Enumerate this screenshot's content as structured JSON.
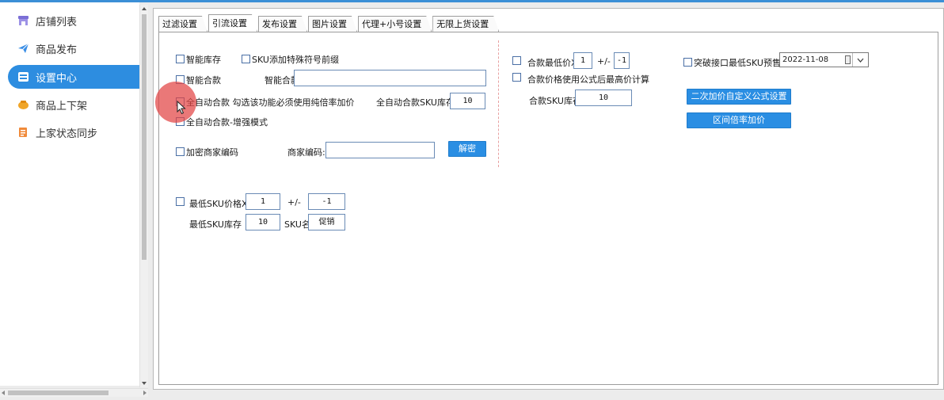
{
  "sidebar": {
    "items": [
      {
        "label": "店铺列表",
        "icon": "store-icon",
        "active": false
      },
      {
        "label": "商品发布",
        "icon": "paper-plane-icon",
        "active": false
      },
      {
        "label": "设置中心",
        "icon": "settings-icon",
        "active": true
      },
      {
        "label": "商品上下架",
        "icon": "shelf-icon",
        "active": false
      },
      {
        "label": "上家状态同步",
        "icon": "sync-document-icon",
        "active": false
      }
    ]
  },
  "tabs": [
    {
      "label": "过滤设置",
      "active": false
    },
    {
      "label": "引流设置",
      "active": true
    },
    {
      "label": "发布设置",
      "active": false
    },
    {
      "label": "图片设置",
      "active": false
    },
    {
      "label": "代理+小号设置",
      "active": false
    },
    {
      "label": "无限上货设置",
      "active": false
    }
  ],
  "left": {
    "smart_stock": "智能库存",
    "sku_special_prefix": "SKU添加特殊符号前缀",
    "smart_merge": "智能合款",
    "smart_merge_link_label": "智能合款链接",
    "smart_merge_link_value": "",
    "auto_merge": "全自动合款 勾选该功能必须使用纯倍率加价",
    "auto_merge_stock_label": "全自动合款SKU库存",
    "auto_merge_stock_value": "10",
    "auto_merge_enhanced": "全自动合款-增强模式",
    "encrypt_merchant_code": "加密商家编码",
    "merchant_code_label": "商家编码:",
    "merchant_code_value": "",
    "decrypt_button": "解密",
    "min_sku_price": "最低SKU价格X",
    "min_sku_price_value": "1",
    "plusminus_label": "+/-",
    "min_sku_offset_value": "-1",
    "min_sku_stock_label": "最低SKU库存",
    "min_sku_stock_value": "10",
    "sku_name_label": "SKU名",
    "sku_name_value": "促销"
  },
  "right": {
    "merge_min_price": "合款最低价X",
    "merge_min_price_value": "1",
    "plusminus_label": "+/-",
    "merge_offset_value": "-1",
    "use_formula_max": "合款价格使用公式后最高价计算",
    "merge_stock_label": "合款SKU库存",
    "merge_stock_value": "10",
    "break_min_sku_presale": "突破接口最低SKU预售",
    "presale_date": "2022-11-08",
    "second_markup_button": "二次加价自定义公式设置",
    "range_markup_button": "区间倍率加价"
  }
}
